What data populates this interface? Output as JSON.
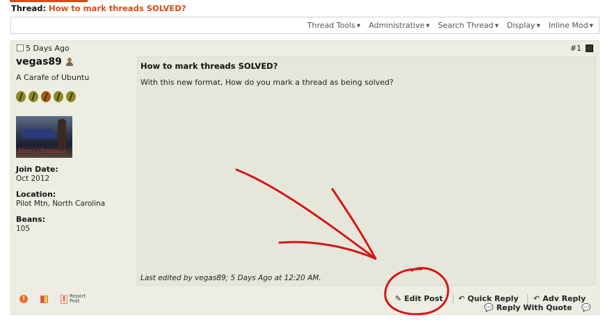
{
  "thread": {
    "prefix": "Thread:",
    "title": "How to mark threads SOLVED?"
  },
  "toolbar": {
    "items": [
      {
        "label": "Thread Tools",
        "icon": "caret-down-icon"
      },
      {
        "label": "Administrative",
        "icon": "caret-down-icon"
      },
      {
        "label": "Search Thread",
        "icon": "caret-down-icon"
      },
      {
        "label": "Display",
        "icon": "caret-down-icon"
      },
      {
        "label": "Inline Mod",
        "icon": "caret-down-icon"
      }
    ]
  },
  "post": {
    "date": "5 Days Ago",
    "number": "#1",
    "user": {
      "name": "vegas89",
      "title": "A Carafe of Ubuntu",
      "avatar_caption": "Merry Christmas",
      "join_label": "Join Date:",
      "join_value": "Oct 2012",
      "location_label": "Location:",
      "location_value": "Pilot Mtn, North Carolina",
      "beans_label": "Beans:",
      "beans_value": "105"
    },
    "title": "How to mark threads SOLVED?",
    "message": "With this new format, How do you mark a thread as being solved?",
    "edited_prefix": "Last edited by vegas89; 5 Days Ago at",
    "edited_time": "12:20 AM",
    "edited_suffix": "."
  },
  "footer": {
    "report_line1": "Report",
    "report_line2": "Post",
    "edit_post": "Edit Post",
    "quick_reply": "Quick Reply",
    "adv_reply": "Adv Reply",
    "reply_quote": "Reply With Quote"
  },
  "colors": {
    "accent": "#d84a12",
    "post_bg": "#edede3",
    "annotation_red": "#d81414"
  }
}
